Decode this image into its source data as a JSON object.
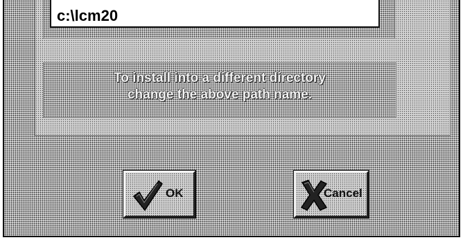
{
  "install_path": {
    "value": "c:\\lcm20"
  },
  "info": {
    "line1": "To install into a different directory",
    "line2": "change the above path name."
  },
  "buttons": {
    "ok": {
      "label": "OK",
      "icon": "checkmark-icon"
    },
    "cancel": {
      "label": "Cancel",
      "icon": "x-icon"
    }
  }
}
